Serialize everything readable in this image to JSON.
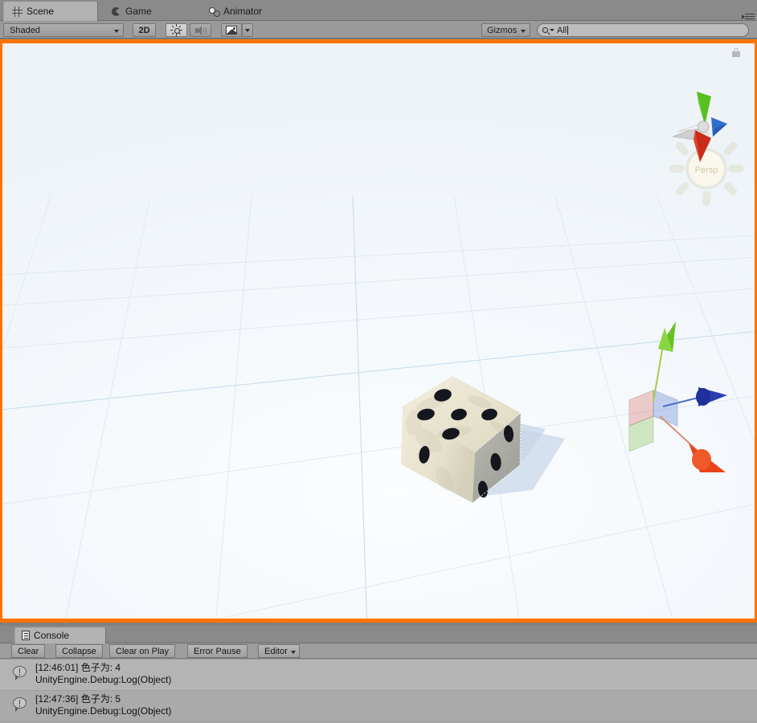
{
  "window": {
    "panel_menu_icon": "panel-menu-icon"
  },
  "tabs": [
    {
      "label": "Scene",
      "icon": "grid-hash-icon",
      "active": true
    },
    {
      "label": "Game",
      "icon": "gamepad-icon",
      "active": false
    },
    {
      "label": "Animator",
      "icon": "animator-icon",
      "active": false
    }
  ],
  "scene_toolbar": {
    "draw_mode": "Shaded",
    "draw_mode_caret": "chevron-down-icon",
    "toggle_2d": "2D",
    "lighting_icon": "sun-icon",
    "audio_icon": "speaker-icon",
    "effects_icon": "image-icon",
    "effects_caret": "chevron-down-icon",
    "gizmos_label": "Gizmos",
    "gizmos_caret": "chevron-down-icon",
    "search": {
      "value": "All",
      "placeholder": "",
      "icon": "search-icon",
      "filter_caret": "chevron-down-icon"
    }
  },
  "scene_view": {
    "focus_border_color": "#ff7300",
    "background_color": "#f6f9fc",
    "grid_color": "#dde7f0",
    "lock_icon": "lock-icon",
    "orientation_gizmo": {
      "label": "Persp",
      "axes": [
        {
          "name": "y-axis-cone",
          "color": "#6abf2e"
        },
        {
          "name": "z-axis-cone",
          "color": "#1d6fd0"
        },
        {
          "name": "x-axis-cone",
          "color": "#c8281a"
        },
        {
          "name": "neg-axis-cone",
          "color": "#b9b9b9"
        }
      ]
    },
    "move_gizmo": {
      "axes": [
        {
          "name": "y-axis-arrow",
          "color": "#5fbf20"
        },
        {
          "name": "z-axis-arrow",
          "color": "#1b4fd0"
        },
        {
          "name": "x-axis-arrow",
          "color": "#e8441a"
        }
      ]
    },
    "object": {
      "name": "dice-cube",
      "top_face_pips": 5,
      "left_face_pips": 1,
      "right_face_pips": 3,
      "body_color": "#ece8d5",
      "pip_color": "#15151f",
      "shadow_color": "#c8d6e8"
    }
  },
  "console": {
    "tab_label": "Console",
    "tab_icon": "console-icon",
    "toolbar": {
      "clear": "Clear",
      "collapse": "Collapse",
      "clear_on_play": "Clear on Play",
      "error_pause": "Error Pause",
      "editor": "Editor",
      "editor_caret": "chevron-down-icon"
    },
    "messages": [
      {
        "icon": "info-icon",
        "line1": "[12:46:01] 色子为: 4",
        "line2": "UnityEngine.Debug:Log(Object)"
      },
      {
        "icon": "info-icon",
        "line1": "[12:47:36] 色子为: 5",
        "line2": "UnityEngine.Debug:Log(Object)"
      }
    ]
  }
}
